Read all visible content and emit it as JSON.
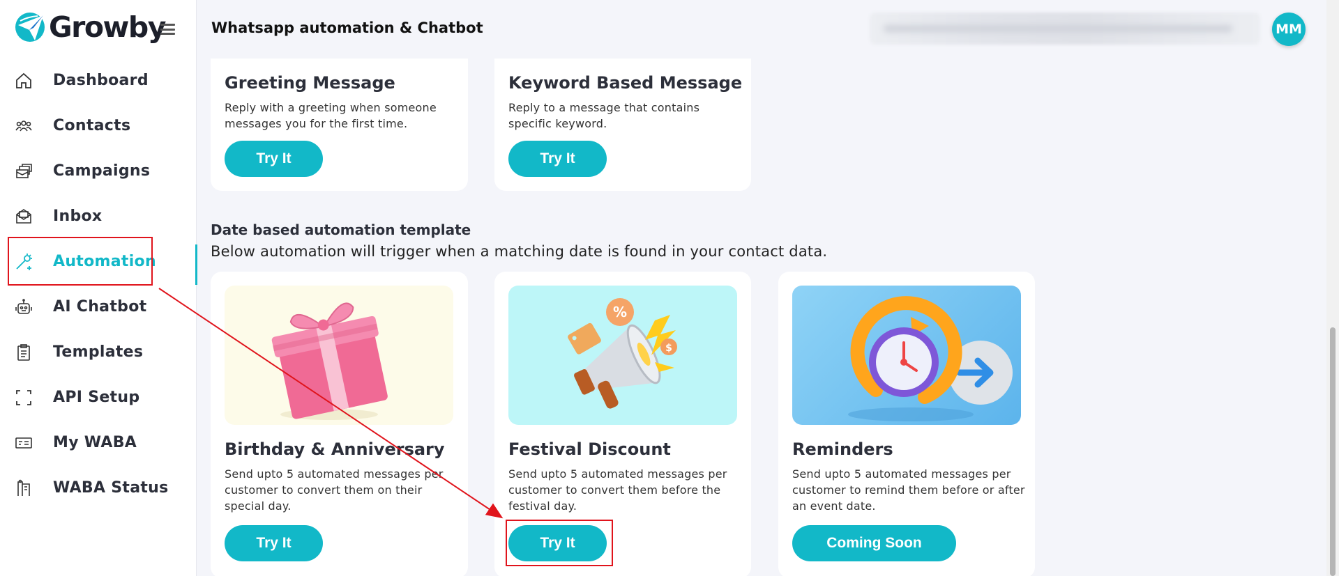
{
  "brand": {
    "name": "Growby",
    "accent": "#12b8c8"
  },
  "sidebar": {
    "items": [
      {
        "label": "Dashboard",
        "icon": "home-icon"
      },
      {
        "label": "Contacts",
        "icon": "users-icon"
      },
      {
        "label": "Campaigns",
        "icon": "campaigns-icon"
      },
      {
        "label": "Inbox",
        "icon": "inbox-icon"
      },
      {
        "label": "Automation",
        "icon": "magic-wand-icon",
        "active": true
      },
      {
        "label": "AI Chatbot",
        "icon": "robot-icon"
      },
      {
        "label": "Templates",
        "icon": "clipboard-icon"
      },
      {
        "label": "API Setup",
        "icon": "scan-icon"
      },
      {
        "label": "My WABA",
        "icon": "card-icon"
      },
      {
        "label": "WABA Status",
        "icon": "status-icon"
      }
    ]
  },
  "header": {
    "title": "Whatsapp automation & Chatbot",
    "avatar_initials": "MM"
  },
  "message_templates": [
    {
      "title": "Greeting Message",
      "description": "Reply with a greeting when someone messages you for the first time.",
      "button": "Try It"
    },
    {
      "title": "Keyword Based Message",
      "description": "Reply to a message that contains specific keyword.",
      "button": "Try It"
    }
  ],
  "date_section": {
    "title": "Date based automation template",
    "subtitle": "Below automation will trigger when a matching date is found in your contact data."
  },
  "date_templates": [
    {
      "title": "Birthday & Anniversary",
      "description": "Send upto 5 automated messages per customer to convert them on their special day.",
      "button": "Try It",
      "image": "gift-box-image"
    },
    {
      "title": "Festival Discount",
      "description": "Send upto 5 automated messages per customer to convert them before the festival day.",
      "button": "Try It",
      "image": "megaphone-image"
    },
    {
      "title": "Reminders",
      "description": "Send upto 5 automated messages per customer to remind them before or after an event date.",
      "button": "Coming Soon",
      "image": "clock-arrow-image"
    }
  ]
}
